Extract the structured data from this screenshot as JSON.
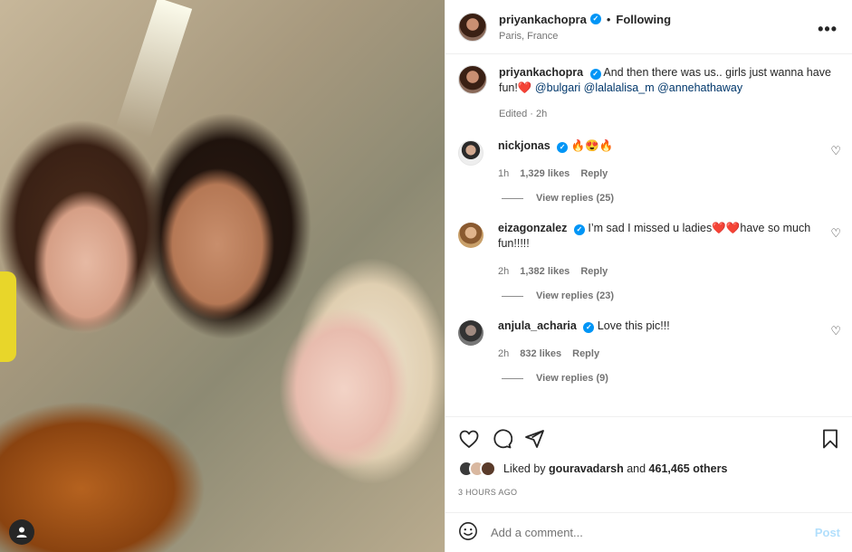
{
  "header": {
    "username": "priyankachopra",
    "separator": "•",
    "follow_status": "Following",
    "location": "Paris, France",
    "more_icon": "more-horizontal-icon",
    "more_glyph": "•••"
  },
  "caption": {
    "username": "priyankachopra",
    "text": "And then there was us.. girls just wanna have fun!",
    "emoji": "❤️",
    "mentions": [
      "@bulgari",
      "@lalalalisa_m",
      "@annehathaway"
    ],
    "edited": "Edited · 2h"
  },
  "comments": [
    {
      "username": "nickjonas",
      "text": "🔥😍🔥",
      "time": "1h",
      "likes": "1,329 likes",
      "reply_label": "Reply",
      "view_replies": "View replies (25)",
      "avatar_color": "#f2f2f2"
    },
    {
      "username": "eizagonzalez",
      "text": "I’m sad I missed u ladies❤️❤️have so much fun!!!!!",
      "time": "2h",
      "likes": "1,382 likes",
      "reply_label": "Reply",
      "view_replies": "View replies (23)",
      "avatar_color": "#c9a06a"
    },
    {
      "username": "anjula_acharia",
      "text": "Love this pic!!!",
      "time": "2h",
      "likes": "832 likes",
      "reply_label": "Reply",
      "view_replies": "View replies (9)",
      "avatar_color": "#6b6b6b"
    }
  ],
  "likes": {
    "prefix": "Liked by",
    "user": "gouravadarsh",
    "and": "and",
    "others": "461,465 others"
  },
  "time_ago": "3 HOURS AGO",
  "add_comment": {
    "placeholder": "Add a comment...",
    "post_label": "Post"
  },
  "colors": {
    "verified": "#0095f6",
    "mention": "#00376b",
    "post_disabled": "#b2dffc"
  }
}
